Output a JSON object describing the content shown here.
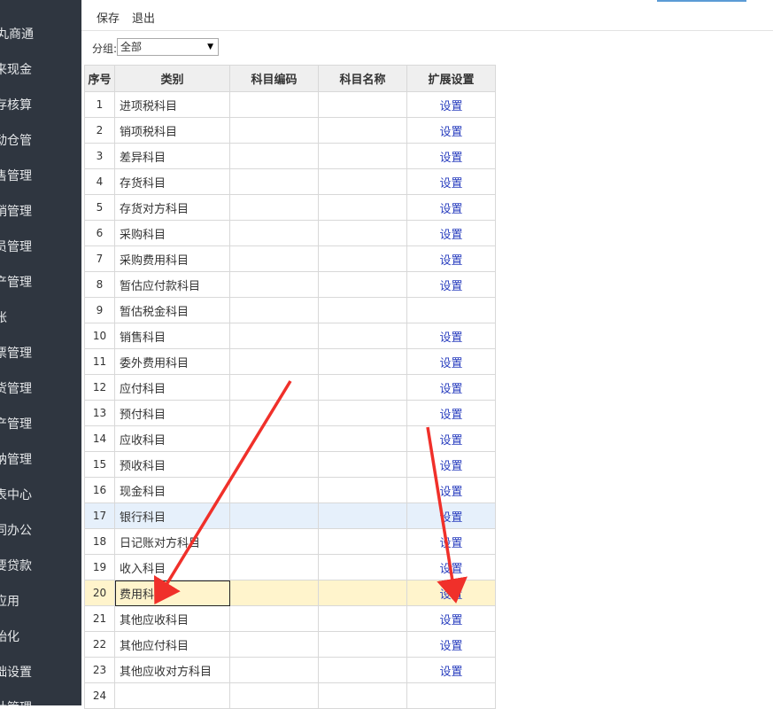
{
  "sidebar": {
    "items": [
      "丸商通",
      "来现金",
      "存核算",
      "动仓管",
      "售管理",
      "销管理",
      "员管理",
      "产管理",
      "账",
      "票管理",
      "货管理",
      "产管理",
      "纳管理",
      "表中心",
      "同办公",
      "要贷款",
      "应用",
      "始化",
      "础设置",
      "计管理"
    ]
  },
  "toolbar": {
    "save_label": "保存",
    "exit_label": "退出"
  },
  "filter": {
    "label": "分组:",
    "value": "全部"
  },
  "table": {
    "headers": [
      "序号",
      "类别",
      "科目编码",
      "科目名称",
      "扩展设置"
    ],
    "rows": [
      {
        "no": "1",
        "category": "进项税科目",
        "link": "设置"
      },
      {
        "no": "2",
        "category": "销项税科目",
        "link": "设置"
      },
      {
        "no": "3",
        "category": "差异科目",
        "link": "设置"
      },
      {
        "no": "4",
        "category": "存货科目",
        "link": "设置"
      },
      {
        "no": "5",
        "category": "存货对方科目",
        "link": "设置"
      },
      {
        "no": "6",
        "category": "采购科目",
        "link": "设置"
      },
      {
        "no": "7",
        "category": "采购费用科目",
        "link": "设置"
      },
      {
        "no": "8",
        "category": "暂估应付款科目",
        "link": "设置"
      },
      {
        "no": "9",
        "category": "暂估税金科目",
        "link": ""
      },
      {
        "no": "10",
        "category": "销售科目",
        "link": "设置"
      },
      {
        "no": "11",
        "category": "委外费用科目",
        "link": "设置"
      },
      {
        "no": "12",
        "category": "应付科目",
        "link": "设置"
      },
      {
        "no": "13",
        "category": "预付科目",
        "link": "设置"
      },
      {
        "no": "14",
        "category": "应收科目",
        "link": "设置"
      },
      {
        "no": "15",
        "category": "预收科目",
        "link": "设置"
      },
      {
        "no": "16",
        "category": "现金科目",
        "link": "设置"
      },
      {
        "no": "17",
        "category": "银行科目",
        "link": "设置"
      },
      {
        "no": "18",
        "category": "日记账对方科目",
        "link": "设置"
      },
      {
        "no": "19",
        "category": "收入科目",
        "link": "设置"
      },
      {
        "no": "20",
        "category": "费用科目",
        "link": "设置"
      },
      {
        "no": "21",
        "category": "其他应收科目",
        "link": "设置"
      },
      {
        "no": "22",
        "category": "其他应付科目",
        "link": "设置"
      },
      {
        "no": "23",
        "category": "其他应收对方科目",
        "link": "设置"
      },
      {
        "no": "24",
        "category": "",
        "link": ""
      }
    ]
  },
  "colors": {
    "sidebar_bg": "#2f3640",
    "link": "#2a3fbf",
    "arrow": "#f0302a",
    "hover_row": "#e6f0fb",
    "selected_row": "#fff4cc"
  }
}
